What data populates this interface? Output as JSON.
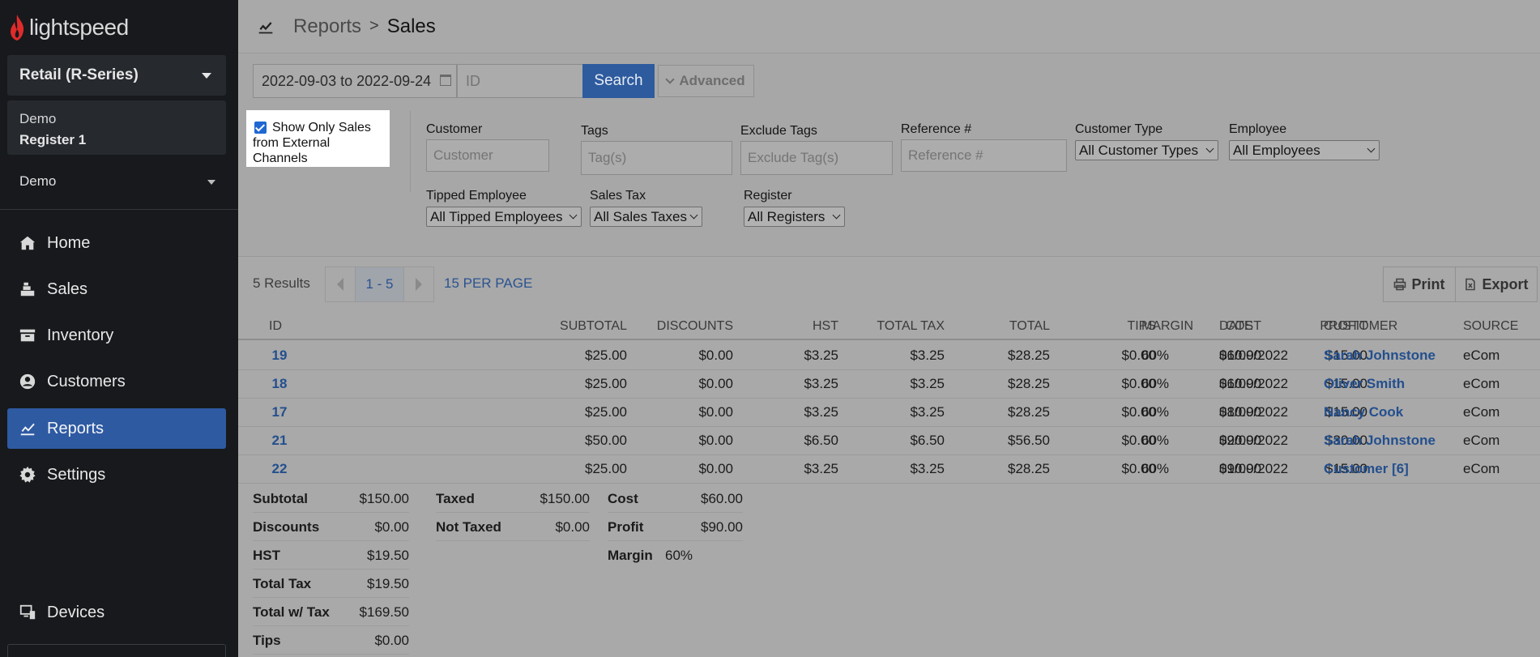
{
  "brand": {
    "name": "lightspeed",
    "accent": "#e02b2b"
  },
  "sidebar": {
    "product": "Retail (R-Series)",
    "register_line1": "Demo",
    "register_line2": "Register 1",
    "user": "Demo",
    "nav": [
      {
        "label": "Home",
        "icon": "home-icon"
      },
      {
        "label": "Sales",
        "icon": "register-icon"
      },
      {
        "label": "Inventory",
        "icon": "inventory-icon"
      },
      {
        "label": "Customers",
        "icon": "customer-icon"
      },
      {
        "label": "Reports",
        "icon": "chart-icon",
        "active": true
      },
      {
        "label": "Settings",
        "icon": "gear-icon"
      },
      {
        "label": "Devices",
        "icon": "devices-icon"
      }
    ]
  },
  "header": {
    "parent": "Reports",
    "current": "Sales"
  },
  "search": {
    "date_range": "2022-09-03 to 2022-09-24",
    "id_placeholder": "ID",
    "search_label": "Search",
    "advanced_label": "Advanced"
  },
  "filters": {
    "external_line1": "Show Only Sales",
    "external_line2": "from External Channels",
    "external_checked": true,
    "customer_label": "Customer",
    "customer_placeholder": "Customer",
    "tags_label": "Tags",
    "tags_placeholder": "Tag(s)",
    "exclude_tags_label": "Exclude Tags",
    "exclude_tags_placeholder": "Exclude Tag(s)",
    "reference_label": "Reference #",
    "reference_placeholder": "Reference #",
    "customer_type_label": "Customer Type",
    "customer_type_value": "All Customer Types",
    "employee_label": "Employee",
    "employee_value": "All Employees",
    "tipped_label": "Tipped Employee",
    "tipped_value": "All Tipped Employees",
    "sales_tax_label": "Sales Tax",
    "sales_tax_value": "All Sales Taxes",
    "register_label": "Register",
    "register_value": "All Registers"
  },
  "results": {
    "count": "5 Results",
    "range": "1 - 5",
    "per_page": "15 PER PAGE",
    "print_label": "Print",
    "export_label": "Export"
  },
  "table": {
    "headers": {
      "id": "ID",
      "subtotal": "SUBTOTAL",
      "discounts": "DISCOUNTS",
      "hst": "HST",
      "total_tax": "TOTAL TAX",
      "total": "TOTAL",
      "tips": "TIPS",
      "cost": "COST",
      "profit": "PROFIT",
      "margin": "MARGIN",
      "date": "DATE",
      "customer": "CUSTOMER",
      "source": "SOURCE"
    },
    "rows": [
      {
        "id": "19",
        "subtotal": "$25.00",
        "discounts": "$0.00",
        "hst": "$3.25",
        "total_tax": "$3.25",
        "total": "$28.25",
        "tips": "$0.00",
        "cost": "$10.00",
        "profit": "$15.00",
        "margin": "60%",
        "date": "06/09/2022",
        "customer": "Sarah Johnstone",
        "source": "eCom"
      },
      {
        "id": "18",
        "subtotal": "$25.00",
        "discounts": "$0.00",
        "hst": "$3.25",
        "total_tax": "$3.25",
        "total": "$28.25",
        "tips": "$0.00",
        "cost": "$10.00",
        "profit": "$15.00",
        "margin": "60%",
        "date": "06/09/2022",
        "customer": "Oliver Smith",
        "source": "eCom"
      },
      {
        "id": "17",
        "subtotal": "$25.00",
        "discounts": "$0.00",
        "hst": "$3.25",
        "total_tax": "$3.25",
        "total": "$28.25",
        "tips": "$0.00",
        "cost": "$10.00",
        "profit": "$15.00",
        "margin": "60%",
        "date": "08/09/2022",
        "customer": "Nancy Cook",
        "source": "eCom"
      },
      {
        "id": "21",
        "subtotal": "$50.00",
        "discounts": "$0.00",
        "hst": "$6.50",
        "total_tax": "$6.50",
        "total": "$56.50",
        "tips": "$0.00",
        "cost": "$20.00",
        "profit": "$30.00",
        "margin": "60%",
        "date": "09/09/2022",
        "customer": "Sarah Johnstone",
        "source": "eCom"
      },
      {
        "id": "22",
        "subtotal": "$25.00",
        "discounts": "$0.00",
        "hst": "$3.25",
        "total_tax": "$3.25",
        "total": "$28.25",
        "tips": "$0.00",
        "cost": "$10.00",
        "profit": "$15.00",
        "margin": "60%",
        "date": "09/09/2022",
        "customer": "Customer [6]",
        "source": "eCom"
      }
    ]
  },
  "totals": {
    "col1": [
      {
        "label": "Subtotal",
        "value": "$150.00"
      },
      {
        "label": "Discounts",
        "value": "$0.00"
      },
      {
        "label": "HST",
        "value": "$19.50"
      },
      {
        "label": "Total Tax",
        "value": "$19.50"
      },
      {
        "label": "Total w/ Tax",
        "value": "$169.50"
      },
      {
        "label": "Tips",
        "value": "$0.00"
      }
    ],
    "col2": [
      {
        "label": "Taxed",
        "value": "$150.00"
      },
      {
        "label": "Not Taxed",
        "value": "$0.00"
      }
    ],
    "col3": [
      {
        "label": "Cost",
        "value": "$60.00"
      },
      {
        "label": "Profit",
        "value": "$90.00"
      },
      {
        "label": "Margin",
        "value": "60%"
      }
    ]
  }
}
